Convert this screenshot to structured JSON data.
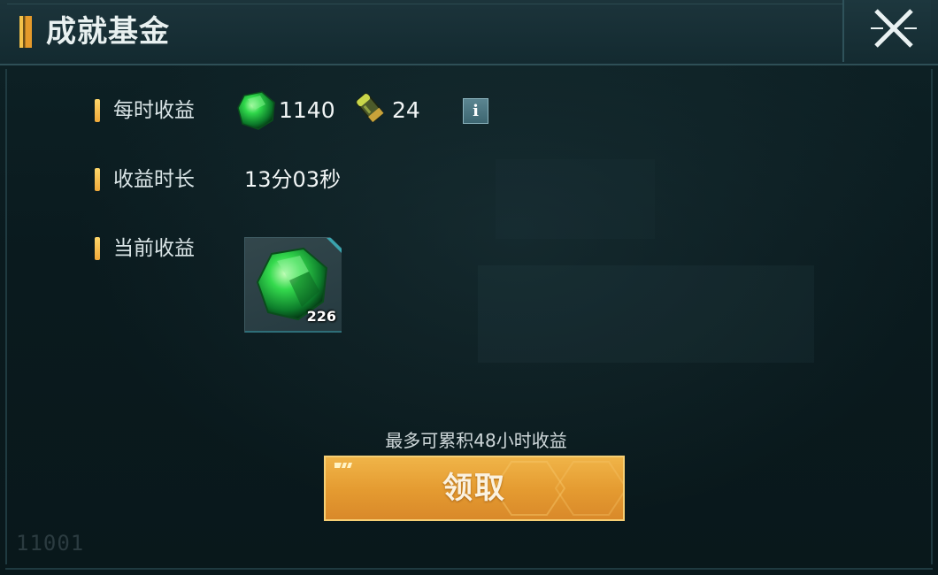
{
  "header": {
    "title": "成就基金"
  },
  "rows": {
    "hourly": {
      "label": "每时收益",
      "green_value": "1140",
      "ammo_value": "24"
    },
    "duration": {
      "label": "收益时长",
      "value": "13分03秒"
    },
    "current": {
      "label": "当前收益",
      "item_count": "226"
    }
  },
  "info_button": {
    "label": "i"
  },
  "footer": {
    "hint": "最多可累积48小时收益",
    "claim_label": "领取"
  },
  "watermark": "11001",
  "icons": {
    "close": "close-x-icon",
    "green_crystal": "green-crystal-icon",
    "ammo": "ammo-shell-icon"
  },
  "colors": {
    "accent_gold": "#f0b448",
    "marker": "#ffd76a",
    "background": "#0b1a1e"
  }
}
